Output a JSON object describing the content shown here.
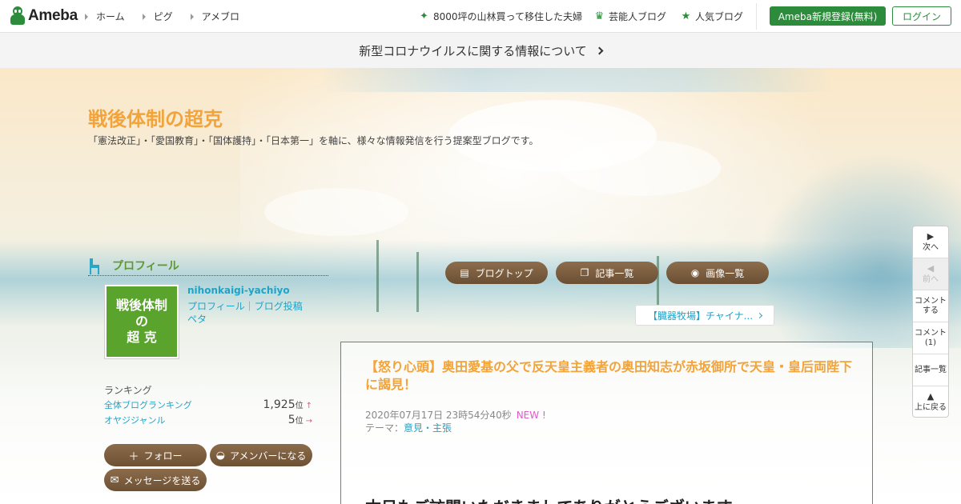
{
  "header": {
    "logo_text": "Ameba",
    "nav": [
      {
        "label": "ホーム"
      },
      {
        "label": "ピグ"
      },
      {
        "label": "アメブロ"
      }
    ],
    "promos": [
      {
        "label": "8000坪の山林買って移住した夫婦",
        "icon": "sparkle-icon"
      },
      {
        "label": "芸能人ブログ",
        "icon": "crown-icon"
      },
      {
        "label": "人気ブログ",
        "icon": "star-icon"
      }
    ],
    "register_label": "Ameba新規登録(無料)",
    "login_label": "ログイン",
    "brand_color": "#2d8c3c"
  },
  "notice": {
    "text": "新型コロナウイルスに関する情報について"
  },
  "blog": {
    "title": "戦後体制の超克",
    "description": "「憲法改正」・「愛国教育」・「国体護持」・「日本第一」を軸に、様々な情報発信を行う提案型ブログです。",
    "title_color": "#f2a33a"
  },
  "profile": {
    "heading": "プロフィール",
    "avatar_lines": [
      "戦後体制",
      "の",
      "超 克"
    ],
    "name": "nihonkaigi-yachiyo",
    "profile_link": "プロフィール",
    "profile_link_extra": "ブログ投稿",
    "link_line2": "ペタ",
    "ranking_label": "ランキング",
    "rankings": [
      {
        "name": "全体ブログランキング",
        "value": "1,925",
        "unit": "位",
        "trend": "↑"
      },
      {
        "name": "オヤジジャンル",
        "value": "5",
        "unit": "位",
        "trend": "→"
      }
    ],
    "follow_label": "フォロー",
    "amember_label": "アメンバーになる",
    "message_label": "メッセージを送る"
  },
  "blognav": {
    "top_label": "ブログトップ",
    "list_label": "記事一覧",
    "images_label": "画像一覧",
    "next_article": "【臓器牧場】チャイナ..."
  },
  "article": {
    "title": "【怒り心頭】奥田愛基の父で反天皇主義者の奥田知志が赤坂御所で天皇・皇后両陛下に謁見！",
    "date": "2020年07月17日 23時54分40秒",
    "new_badge": "NEW !",
    "theme_label": "テーマ：",
    "theme": "意見・主張",
    "body_start": "本日もご訪問いただきましてありがとうございます。"
  },
  "pager": {
    "next": "次へ",
    "prev": "前へ",
    "comment_line1": "コメント",
    "comment_line2": "する",
    "comments_line1": "コメント",
    "comments_line2": "(1)",
    "list": "記事一覧",
    "top_line1": "上に戻る"
  }
}
